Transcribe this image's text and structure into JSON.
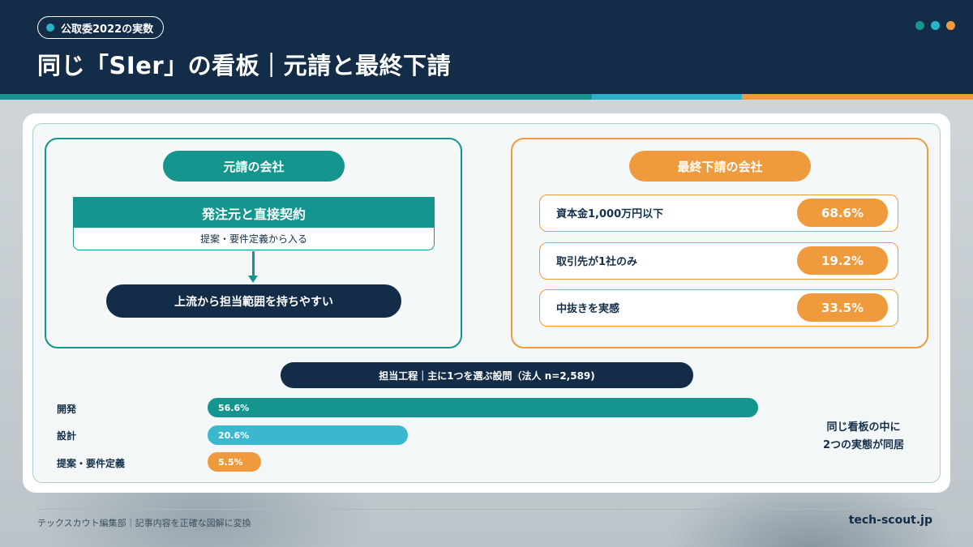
{
  "header": {
    "tag": "公取委2022の実数",
    "title": "同じ「SIer」の看板｜元請と最終下請",
    "dot_colors": [
      "#14968f",
      "#2ab3c6",
      "#ef9a3c"
    ]
  },
  "left_panel": {
    "heading": "元請の会社",
    "contract_title": "発注元と直接契約",
    "contract_sub": "提案・要件定義から入る",
    "result": "上流から担当範囲を持ちやすい"
  },
  "right_panel": {
    "heading": "最終下請の会社",
    "stats": [
      {
        "label": "資本金1,000万円以下",
        "value": "68.6%"
      },
      {
        "label": "取引先が1社のみ",
        "value": "19.2%"
      },
      {
        "label": "中抜きを実感",
        "value": "33.5%"
      }
    ]
  },
  "chart_data": {
    "type": "bar",
    "title": "担当工程｜主に1つを選ぶ設問（法人 n=2,589)",
    "categories": [
      "開発",
      "設計",
      "提案・要件定義"
    ],
    "values": [
      56.6,
      20.6,
      5.5
    ],
    "value_labels": [
      "56.6%",
      "20.6%",
      "5.5%"
    ],
    "colors": [
      "#14968f",
      "#3bb8cf",
      "#ef9a3c"
    ]
  },
  "note": {
    "line1": "同じ看板の中に",
    "line2": "2つの実態が同居"
  },
  "footer": {
    "left": "テックスカウト編集部｜記事内容を正確な図解に変換",
    "right": "tech-scout.jp"
  },
  "colors": {
    "navy": "#132c48",
    "teal": "#14968f",
    "cyan": "#3bb8cf",
    "orange": "#ef9a3c"
  }
}
